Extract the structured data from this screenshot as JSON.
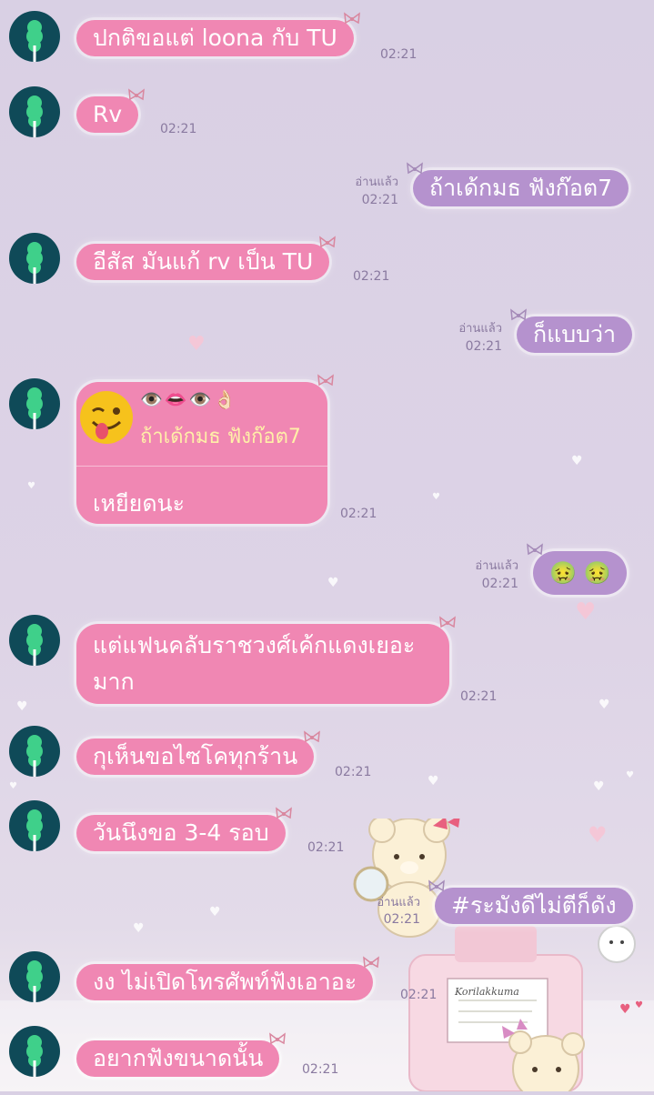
{
  "colors": {
    "incoming_bubble": "#f087b3",
    "outgoing_bubble": "#b592ce",
    "avatar_bg": "#0f4a58",
    "avatar_icon": "#3fd08a",
    "reply_name": "#fff0a8"
  },
  "messages": [
    {
      "side": "in",
      "text": "ปกติขอแต่ loona กับ TU",
      "time": "02:21"
    },
    {
      "side": "in",
      "text": "Rv",
      "time": "02:21"
    },
    {
      "side": "out",
      "text": "ถ้าเด้กมธ ฟังก๊อต7",
      "time": "02:21",
      "read": "อ่านแล้ว"
    },
    {
      "side": "in",
      "text": "อีสัส มันแก้ rv เป็น TU",
      "time": "02:21"
    },
    {
      "side": "out",
      "text": "ก็แบบว่า",
      "time": "02:21",
      "read": "อ่านแล้ว"
    },
    {
      "side": "in",
      "reply_icons": "👁️👄👁️👌🏻",
      "reply_name": "ถ้าเด้กมธ ฟังก๊อต7",
      "text": "เหยียดนะ",
      "time": "02:21",
      "reply_emoji": "winking-tongue-face-emoji"
    },
    {
      "side": "out",
      "text": "🤢 🤢",
      "time": "02:21",
      "read": "อ่านแล้ว"
    },
    {
      "side": "in",
      "text_line1": "แต่แฟนคลับราชวงศ์เค้กแดงเยอะ",
      "text_line2": "มาก",
      "time": "02:21"
    },
    {
      "side": "in",
      "text": "กุเห็นขอไซโคทุกร้าน",
      "time": "02:21"
    },
    {
      "side": "in",
      "text": "วันนึงขอ 3-4 รอบ",
      "time": "02:21"
    },
    {
      "side": "out",
      "text": "#ระมังดีไม่ตีก็ดัง",
      "time": "02:21",
      "read": "อ่านแล้ว"
    },
    {
      "side": "in",
      "text": "งง ไม่เปิดโทรศัพท์ฟังเอาอะ",
      "time": "02:21"
    },
    {
      "side": "in",
      "text": "อยากฟังขนาดนั้น",
      "time": "02:21"
    }
  ],
  "background_sticker": {
    "icon": "korilakkuma-bear-illustration",
    "label": "Korilakkuma"
  }
}
